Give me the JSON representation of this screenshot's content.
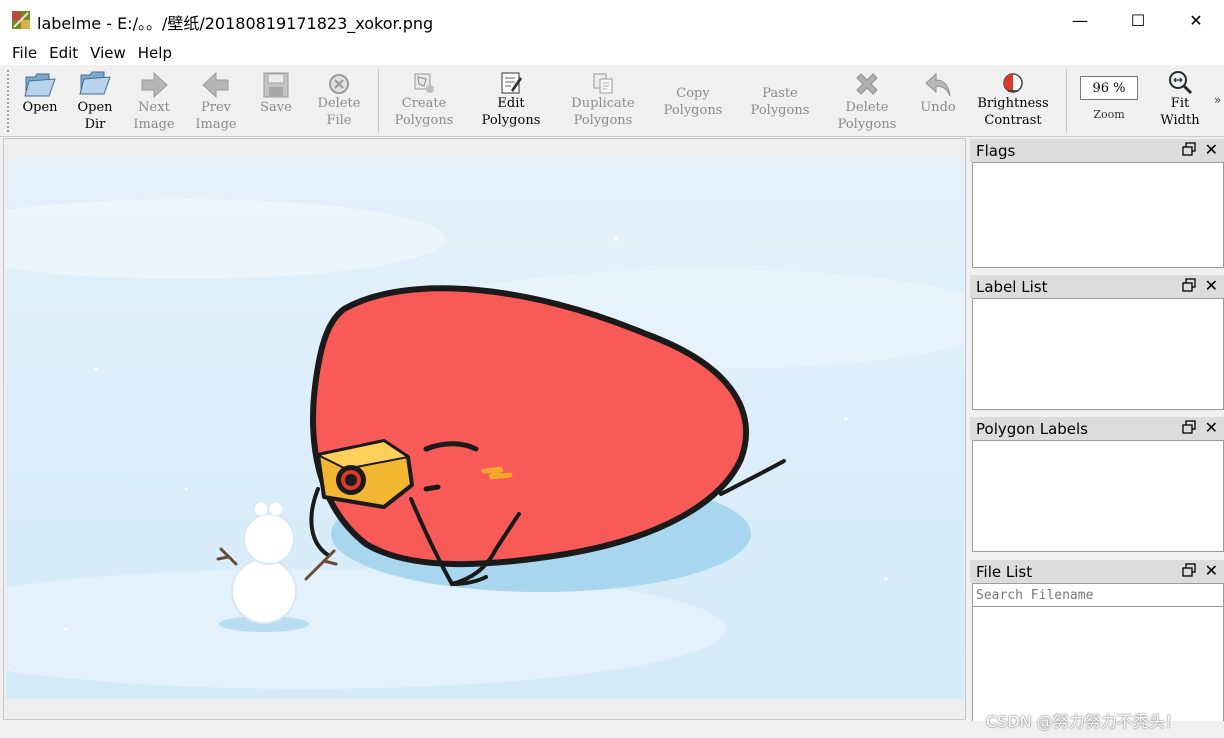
{
  "window": {
    "title": "labelme - E:/。。/壁纸/20180819171823_xokor.png",
    "minimize": "—",
    "maximize": "☐",
    "close": "✕"
  },
  "menu": [
    "File",
    "Edit",
    "View",
    "Help"
  ],
  "toolbar": {
    "open": "Open",
    "open_dir": "Open\nDir",
    "next_image": "Next\nImage",
    "prev_image": "Prev\nImage",
    "save": "Save",
    "delete_file": "Delete\nFile",
    "create_polygons": "Create\nPolygons",
    "edit_polygons": "Edit\nPolygons",
    "duplicate_polygons": "Duplicate\nPolygons",
    "copy_polygons": "Copy\nPolygons",
    "paste_polygons": "Paste\nPolygons",
    "delete_polygons": "Delete\nPolygons",
    "undo": "Undo",
    "brightness_contrast": "Brightness\nContrast",
    "zoom_value": "96 %",
    "zoom_label": "Zoom",
    "fit_width": "Fit\nWidth",
    "more": "»"
  },
  "docks": {
    "flags": "Flags",
    "label_list": "Label List",
    "polygon_labels": "Polygon Labels",
    "file_list": "File List",
    "search_placeholder": "Search Filename",
    "close_glyph": "✕"
  },
  "watermark": "CSDN @努力努力不秃头！",
  "colors": {
    "bird": "#f85a58",
    "camera": "#f2b630",
    "snow": "#dff0fa",
    "accent_red": "#d93a2b"
  },
  "icons": [
    "app-icon",
    "folder-open-icon",
    "arrow-right-icon",
    "arrow-left-icon",
    "floppy-icon",
    "delete-circle-icon",
    "polygon-create-icon",
    "edit-icon",
    "duplicate-icon",
    "cross-icon",
    "undo-icon",
    "brightness-icon",
    "magnifier-icon",
    "restore-icon"
  ]
}
